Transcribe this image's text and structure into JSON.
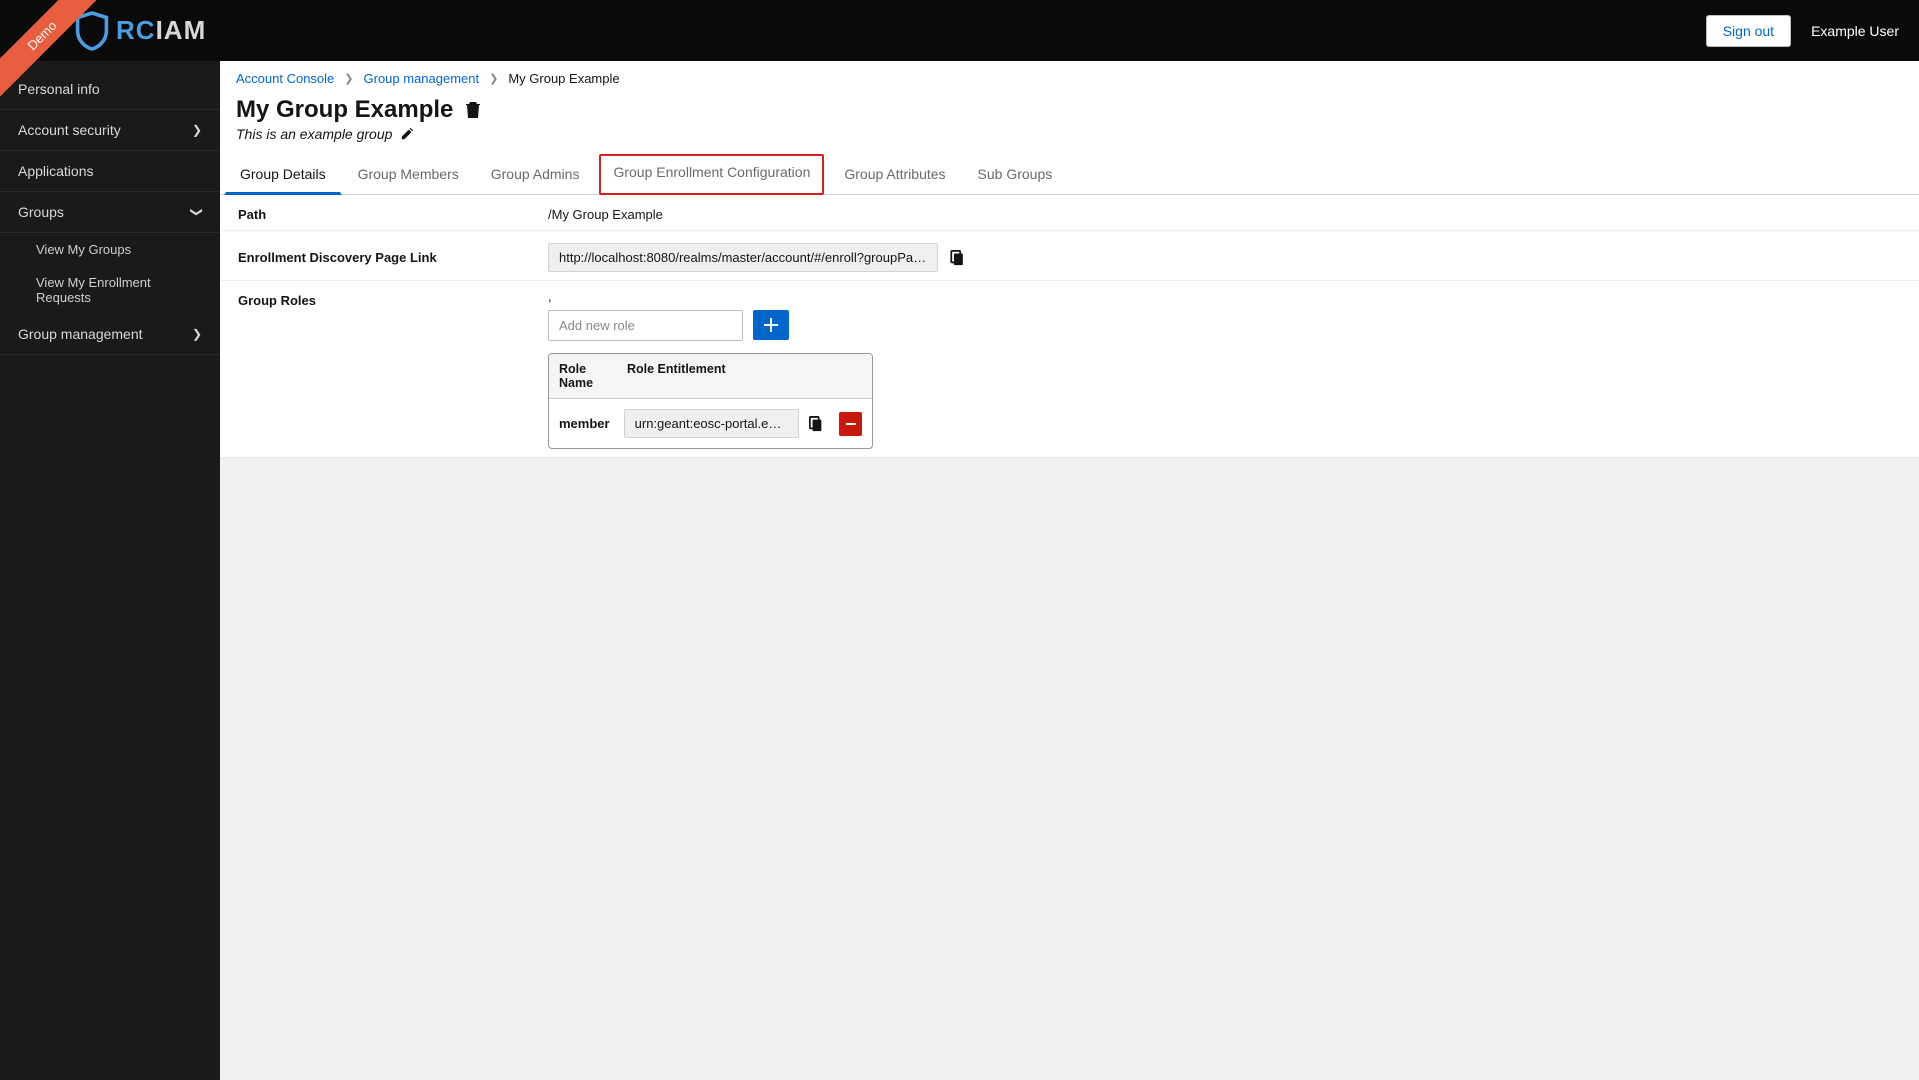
{
  "ribbon": "Demo",
  "logo": {
    "rc": "RC",
    "iam": "IAM"
  },
  "header": {
    "signout": "Sign out",
    "user": "Example User"
  },
  "sidebar": {
    "personal_info": "Personal info",
    "account_security": "Account security",
    "applications": "Applications",
    "groups": "Groups",
    "view_my_groups": "View My Groups",
    "view_my_enrollment_requests": "View My Enrollment Requests",
    "group_management": "Group management"
  },
  "breadcrumb": {
    "account_console": "Account Console",
    "group_management": "Group management",
    "current": "My Group Example"
  },
  "page": {
    "title": "My Group Example",
    "description": "This is an example group"
  },
  "tabs": {
    "details": "Group Details",
    "members": "Group Members",
    "admins": "Group Admins",
    "enrollment_config": "Group Enrollment Configuration",
    "attributes": "Group Attributes",
    "subgroups": "Sub Groups"
  },
  "props": {
    "path_label": "Path",
    "path_value": "/My Group Example",
    "enrollment_label": "Enrollment Discovery Page Link",
    "enrollment_value": "http://localhost:8080/realms/master/account/#/enroll?groupPath= ...",
    "roles_label": "Group Roles",
    "roles_leading": ",",
    "add_role_placeholder": "Add new role",
    "role_table": {
      "col_name": "Role Name",
      "col_entitlement": "Role Entitlement",
      "rows": [
        {
          "name": "member",
          "entitlement": "urn:geant:eosc-portal.eu:grou ..."
        }
      ]
    }
  }
}
